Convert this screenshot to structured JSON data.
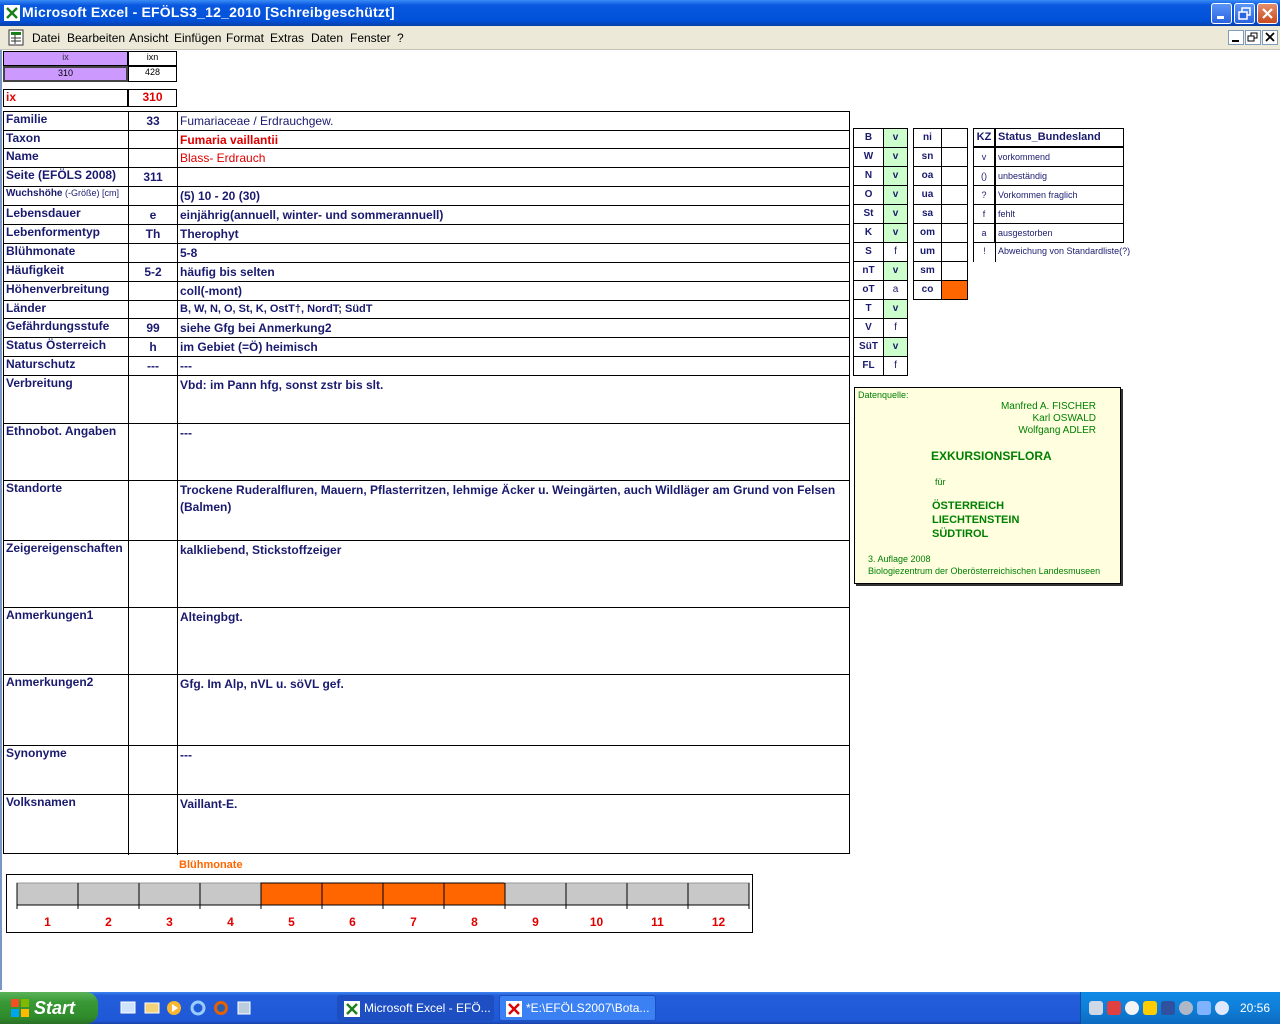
{
  "window": {
    "title": "Microsoft Excel - EFÖLS3_12_2010  [Schreibgeschützt]"
  },
  "menu": [
    "Datei",
    "Bearbeiten",
    "Ansicht",
    "Einfügen",
    "Format",
    "Extras",
    "Daten",
    "Fenster",
    "?"
  ],
  "topcells": {
    "h1": "ix",
    "h2": "ixn",
    "v1": "310",
    "v2": "428",
    "ix_label": "ix",
    "ix_value": "310"
  },
  "rows": [
    {
      "label": "Familie",
      "code": "33",
      "value": "Fumariaceae  /  Erdrauchgew.",
      "style": "plain"
    },
    {
      "label": "Taxon",
      "code": "",
      "value": "Fumaria vaillantii",
      "style": "redbold"
    },
    {
      "label": "Name",
      "code": "",
      "value": "Blass- Erdrauch",
      "style": "red"
    },
    {
      "label": "Seite (EFÖLS 2008)",
      "code": "311",
      "value": "",
      "style": "bold"
    },
    {
      "label": "Wuchshöhe",
      "label_suffix": " (-Größe) [cm]",
      "code": "",
      "value": " (5) 10 - 20 (30)",
      "style": "bold"
    },
    {
      "label": "Lebensdauer",
      "code": "e",
      "value": "einjährig(annuell, winter- und sommerannuell)",
      "style": "bold"
    },
    {
      "label": "Lebenformentyp",
      "code": "Th",
      "value": "Therophyt",
      "style": "bold"
    },
    {
      "label": "Blühmonate",
      "code": "",
      "value": " 5-8",
      "style": "bold"
    },
    {
      "label": "Häufigkeit",
      "code": "5-2",
      "value": "häufig bis selten",
      "style": "bold"
    },
    {
      "label": "Höhenverbreitung",
      "code": "",
      "value": "coll(-mont)",
      "style": "bold"
    },
    {
      "label": "Länder",
      "code": "",
      "value": "B, W, N, O, St, K, OstT†, NordT; SüdT",
      "style": "boldsmall"
    },
    {
      "label": "Gefährdungsstufe",
      "code": "99",
      "value": "siehe Gfg bei Anmerkung2",
      "style": "bold"
    },
    {
      "label": "Status Österreich",
      "code": "h",
      "value": "im Gebiet (=Ö) heimisch",
      "style": "bold"
    },
    {
      "label": "Naturschutz",
      "code": "---",
      "value": "---",
      "style": "bold"
    },
    {
      "label": "Verbreitung",
      "code": "",
      "value": "Vbd: im Pann hfg, sonst zstr bis slt.",
      "style": "bold"
    },
    {
      "label": "Ethnobot. Angaben",
      "code": "",
      "value": "---",
      "style": "bold"
    },
    {
      "label": "Standorte",
      "code": "",
      "value": "Trockene Ruderalfluren, Mauern, Pflasterritzen, lehmige Äcker u. Weingärten, auch Wildläger am Grund von Felsen",
      "value2": "(Balmen)",
      "style": "bold"
    },
    {
      "label": "Zeigereigenschaften",
      "code": "",
      "value": "kalkliebend, Stickstoffzeiger",
      "style": "bold"
    },
    {
      "label": "Anmerkungen1",
      "code": "",
      "value": "Alteingbgt.",
      "style": "bold"
    },
    {
      "label": "Anmerkungen2",
      "code": "",
      "value": "Gfg. Im Alp, nVL u. söVL gef.",
      "style": "bold"
    },
    {
      "label": "Synonyme",
      "code": "",
      "value": "---",
      "style": "bold"
    },
    {
      "label": "Volksnamen",
      "code": "",
      "value": "Vaillant-E.",
      "style": "bold"
    }
  ],
  "regions": [
    {
      "code": "B",
      "status": "v"
    },
    {
      "code": "W",
      "status": "v"
    },
    {
      "code": "N",
      "status": "v"
    },
    {
      "code": "O",
      "status": "v"
    },
    {
      "code": "St",
      "status": "v"
    },
    {
      "code": "K",
      "status": "v"
    },
    {
      "code": "S",
      "status": "f"
    },
    {
      "code": "nT",
      "status": "v"
    },
    {
      "code": "oT",
      "status": "a"
    },
    {
      "code": "T",
      "status": "v"
    },
    {
      "code": "V",
      "status": "f"
    },
    {
      "code": "SüT",
      "status": "v"
    },
    {
      "code": "FL",
      "status": "f"
    }
  ],
  "altitude": [
    {
      "code": "ni",
      "highlight": false
    },
    {
      "code": "sn",
      "highlight": false
    },
    {
      "code": "oa",
      "highlight": false
    },
    {
      "code": "ua",
      "highlight": false
    },
    {
      "code": "sa",
      "highlight": false
    },
    {
      "code": "om",
      "highlight": false
    },
    {
      "code": "um",
      "highlight": false
    },
    {
      "code": "sm",
      "highlight": false
    },
    {
      "code": "co",
      "highlight": true
    }
  ],
  "legend": {
    "kz_header": "KZ",
    "status_header": "Status_Bundesland",
    "items": [
      {
        "kz": "v",
        "text": "vorkommend"
      },
      {
        "kz": "()",
        "text": "unbeständig"
      },
      {
        "kz": "?",
        "text": "Vorkommen fraglich"
      },
      {
        "kz": "f",
        "text": "fehlt"
      },
      {
        "kz": "a",
        "text": "ausgestorben"
      },
      {
        "kz": "!",
        "text": "Abweichung von Standardliste(?)"
      }
    ]
  },
  "source": {
    "label": "Datenquelle:",
    "authors": [
      "Manfred A. FISCHER",
      "Karl OSWALD",
      "Wolfgang ADLER"
    ],
    "book": "EXKURSIONSFLORA",
    "fuer": "für",
    "countries": [
      "ÖSTERREICH",
      "LIECHTENSTEIN",
      "SÜDTIROL"
    ],
    "edition": "3. Auflage 2008",
    "publisher": "Biologiezentrum der Oberösterreichischen Landesmuseen"
  },
  "chart_data": {
    "type": "bar",
    "title": "Blühmonate",
    "categories": [
      "1",
      "2",
      "3",
      "4",
      "5",
      "6",
      "7",
      "8",
      "9",
      "10",
      "11",
      "12"
    ],
    "values": [
      0,
      0,
      0,
      0,
      1,
      1,
      1,
      1,
      0,
      0,
      0,
      0
    ],
    "active_color": "#ff6600",
    "inactive_color": "#c8c8c8"
  },
  "taskbar": {
    "start": "Start",
    "task1": "Microsoft Excel - EFÖ...",
    "task2": "*E:\\EFÖLS2007\\Bota...",
    "clock": "20:56"
  }
}
